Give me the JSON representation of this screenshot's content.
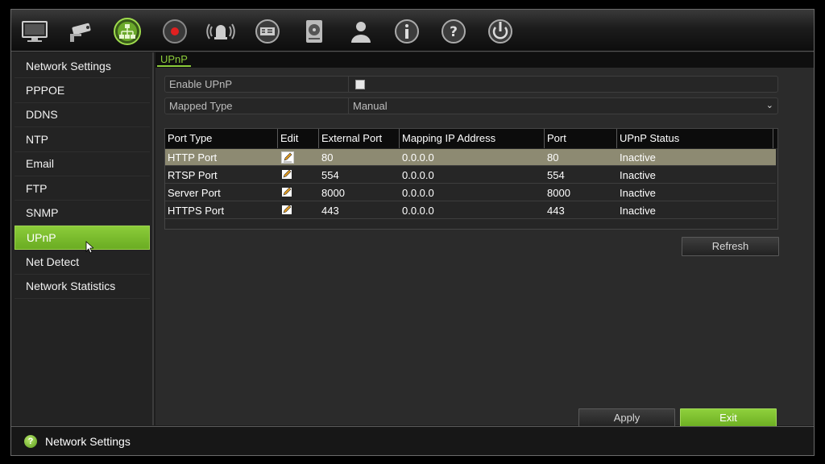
{
  "toolbar": {
    "icons": [
      "monitor-icon",
      "camera-icon",
      "network-icon",
      "record-icon",
      "alarm-icon",
      "device-icon",
      "hdd-icon",
      "user-icon",
      "info-icon",
      "help-icon",
      "power-icon"
    ],
    "active_icon": "network-icon"
  },
  "sidebar": {
    "items": [
      {
        "label": "Network Settings"
      },
      {
        "label": "PPPOE"
      },
      {
        "label": "DDNS"
      },
      {
        "label": "NTP"
      },
      {
        "label": "Email"
      },
      {
        "label": "FTP"
      },
      {
        "label": "SNMP"
      },
      {
        "label": "UPnP",
        "active": true
      },
      {
        "label": "Net Detect"
      },
      {
        "label": "Network Statistics"
      }
    ]
  },
  "main": {
    "tab": "UPnP",
    "enable_upnp": {
      "label": "Enable UPnP",
      "checked": false
    },
    "mapped_type": {
      "label": "Mapped Type",
      "value": "Manual"
    },
    "table": {
      "headers": [
        "Port Type",
        "Edit",
        "External Port",
        "Mapping IP Address",
        "Port",
        "UPnP Status"
      ],
      "rows": [
        {
          "port_type": "HTTP Port",
          "external_port": "80",
          "mapping_ip": "0.0.0.0",
          "port": "80",
          "status": "Inactive",
          "selected": true
        },
        {
          "port_type": "RTSP Port",
          "external_port": "554",
          "mapping_ip": "0.0.0.0",
          "port": "554",
          "status": "Inactive"
        },
        {
          "port_type": "Server Port",
          "external_port": "8000",
          "mapping_ip": "0.0.0.0",
          "port": "8000",
          "status": "Inactive"
        },
        {
          "port_type": "HTTPS Port",
          "external_port": "443",
          "mapping_ip": "0.0.0.0",
          "port": "443",
          "status": "Inactive"
        }
      ]
    },
    "refresh_label": "Refresh",
    "apply_label": "Apply",
    "exit_label": "Exit"
  },
  "statusbar": {
    "icon": "help-icon",
    "text": "Network Settings"
  },
  "colors": {
    "accent_green": "#8ccc3a",
    "selected_row": "#8d8a72"
  }
}
